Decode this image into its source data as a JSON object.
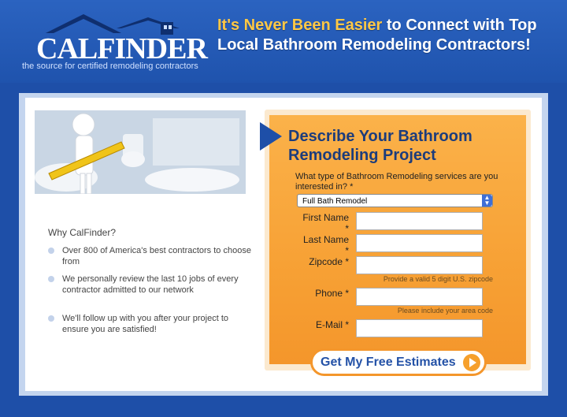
{
  "header": {
    "logo_text": "CALFINDER",
    "tagline": "the source for certified remodeling contractors",
    "headline_highlight": "It's Never Been Easier",
    "headline_rest": " to Connect with Top Local Bathroom Remodeling Contractors!"
  },
  "why": {
    "title": "Why CalFinder?",
    "bullets": [
      "Over 800 of America's best contractors to choose from",
      "We personally review the last 10 jobs of every contractor admitted to our network",
      "We'll follow up with you after your project to ensure you are satisfied!"
    ]
  },
  "form": {
    "title": "Describe Your Bathroom Remodeling Project",
    "question": "What type of Bathroom Remodeling services are you interested in? *",
    "service_selected": "Full Bath Remodel",
    "first_name_label": "First Name *",
    "last_name_label": "Last Name *",
    "zipcode_label": "Zipcode *",
    "zipcode_hint": "Provide a valid 5 digit U.S. zipcode",
    "phone_label": "Phone *",
    "phone_hint": "Please include your area code",
    "email_label": "E-Mail *",
    "submit_label": "Get My Free Estimates"
  },
  "colors": {
    "brand_blue": "#1e4fa8",
    "accent_orange": "#f7a135",
    "highlight_yellow": "#ffc845"
  }
}
